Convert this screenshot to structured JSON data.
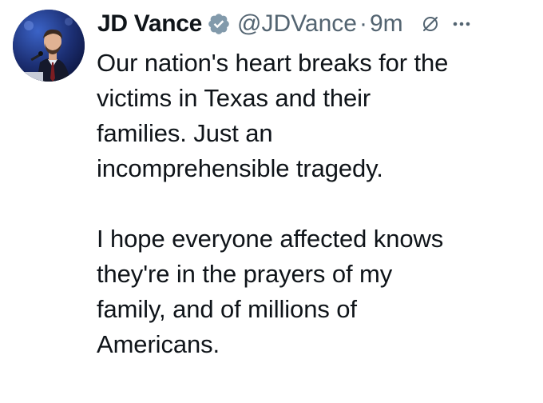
{
  "tweet": {
    "author": {
      "display_name": "JD Vance",
      "handle": "@JDVance",
      "verified": true,
      "avatar_icon": "avatar-photo"
    },
    "separator": "·",
    "timestamp": "9m",
    "icons": {
      "verified": "verified-badge-icon",
      "grok": "grok-icon",
      "more": "more-options-icon"
    },
    "colors": {
      "text": "#0f1419",
      "secondary_text": "#536471",
      "badge": "#829aab"
    },
    "text": "Our nation's heart breaks for the\nvictims in Texas and their\nfamilies. Just an\nincomprehensible tragedy.\n\nI hope everyone affected knows\nthey're in the prayers of my\nfamily, and of millions of\nAmericans."
  }
}
